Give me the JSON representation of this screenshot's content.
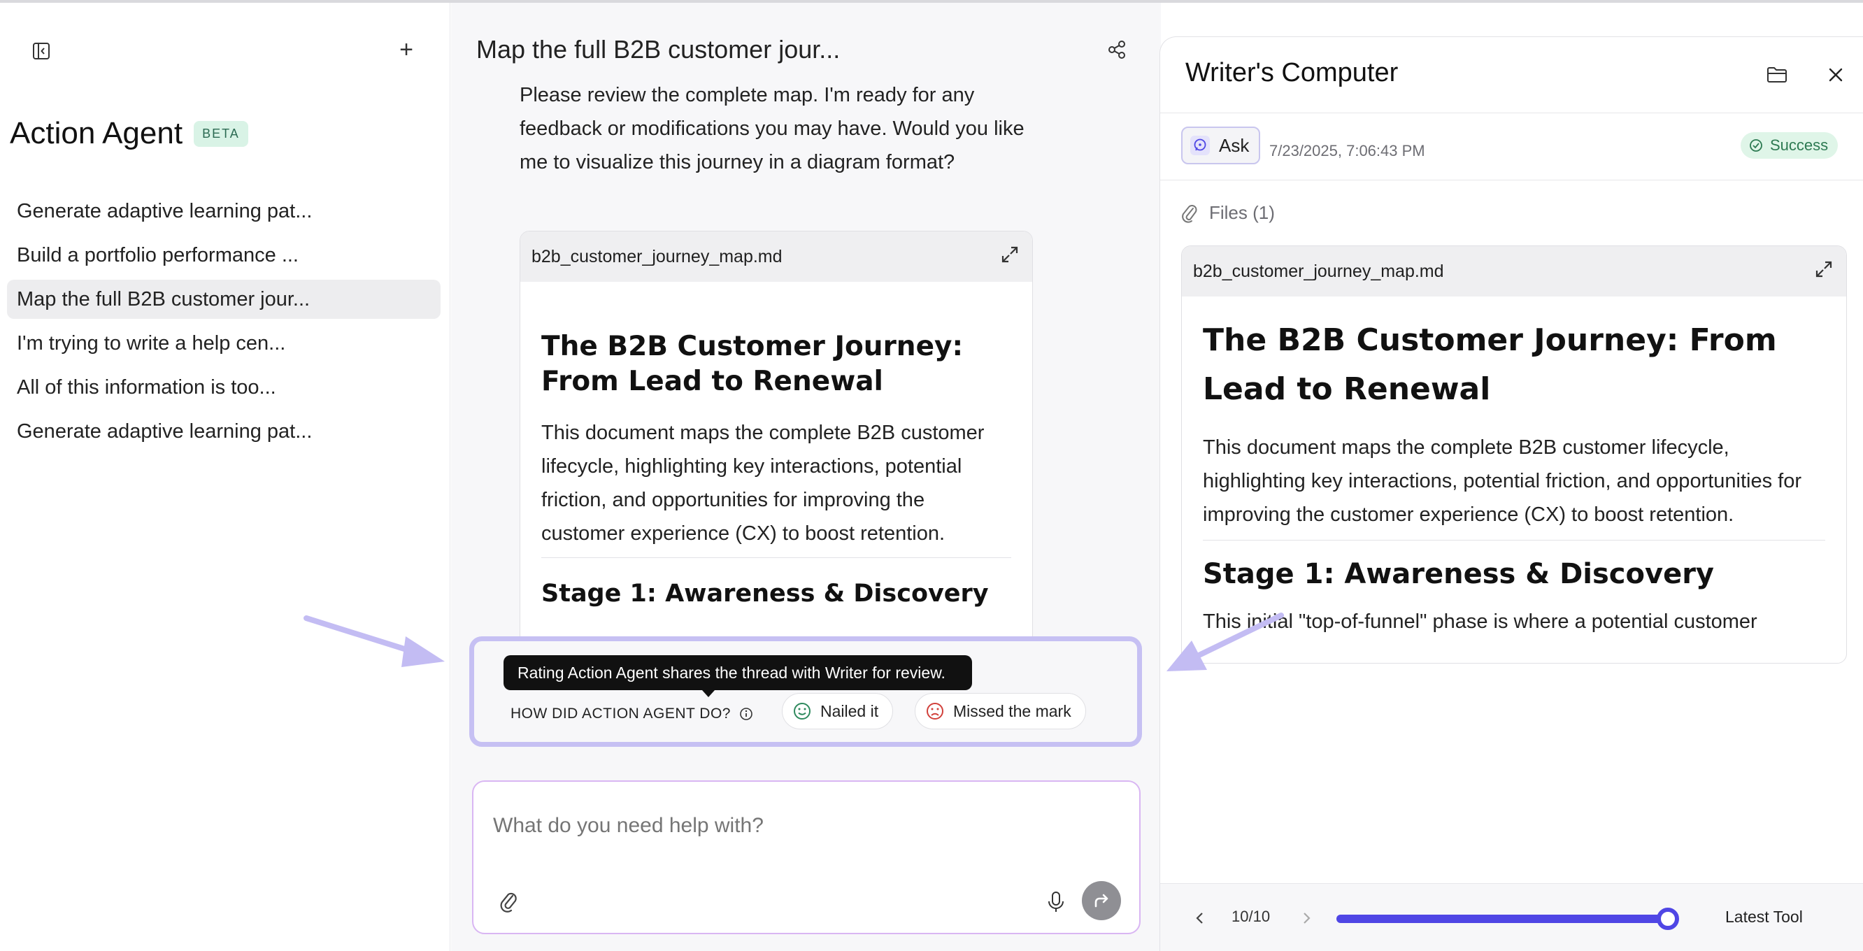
{
  "sidebar": {
    "title": "Action Agent",
    "badge": "BETA",
    "new_chat_symbol": "+",
    "items": [
      {
        "label": "Generate adaptive learning pat..."
      },
      {
        "label": "Build a portfolio performance ..."
      },
      {
        "label": "Map the full B2B customer jour...",
        "active": true
      },
      {
        "label": "I'm trying to write a help cen..."
      },
      {
        "label": "All of this information is too..."
      },
      {
        "label": "Generate adaptive learning pat..."
      }
    ]
  },
  "main": {
    "title": "Map the full B2B customer jour...",
    "message": "Please review the complete map. I'm ready for any feedback or modifications you may have. Would you like me to visualize this journey in a diagram format?",
    "file": {
      "name": "b2b_customer_journey_map.md",
      "h1": "The B2B Customer Journey: From Lead to Renewal",
      "p": "This document maps the complete B2B customer lifecycle, highlighting key interactions, potential friction, and opportunities for improving the customer experience (CX) to boost retention.",
      "h2": "Stage 1: Awareness & Discovery"
    },
    "rating": {
      "tooltip": "Rating Action Agent shares the thread with Writer for review.",
      "label": "HOW DID ACTION AGENT DO?",
      "positive": "Nailed it",
      "negative": "Missed the mark"
    },
    "input": {
      "placeholder": "What do you need help with?"
    }
  },
  "panel": {
    "title": "Writer's Computer",
    "ask_label": "Ask",
    "timestamp": "7/23/2025, 7:06:43 PM",
    "status": "Success",
    "files_label": "Files (1)",
    "file": {
      "name": "b2b_customer_journey_map.md",
      "h1": "The B2B Customer Journey: From Lead to Renewal",
      "p": "This document maps the complete B2B customer lifecycle, highlighting key interactions, potential friction, and opportunities for improving the customer experience (CX) to boost retention.",
      "h2": "Stage 1: Awareness & Discovery",
      "p2": "This initial \"top-of-funnel\" phase is where a potential customer"
    },
    "footer": {
      "page": "10/10",
      "progress": 1.0,
      "latest_label": "Latest Tool"
    }
  },
  "colors": {
    "accent": "#4f46e5",
    "annotation": "#c6c0f3",
    "success_bg": "#dff5e8",
    "beta_bg": "#d9f3e6"
  }
}
